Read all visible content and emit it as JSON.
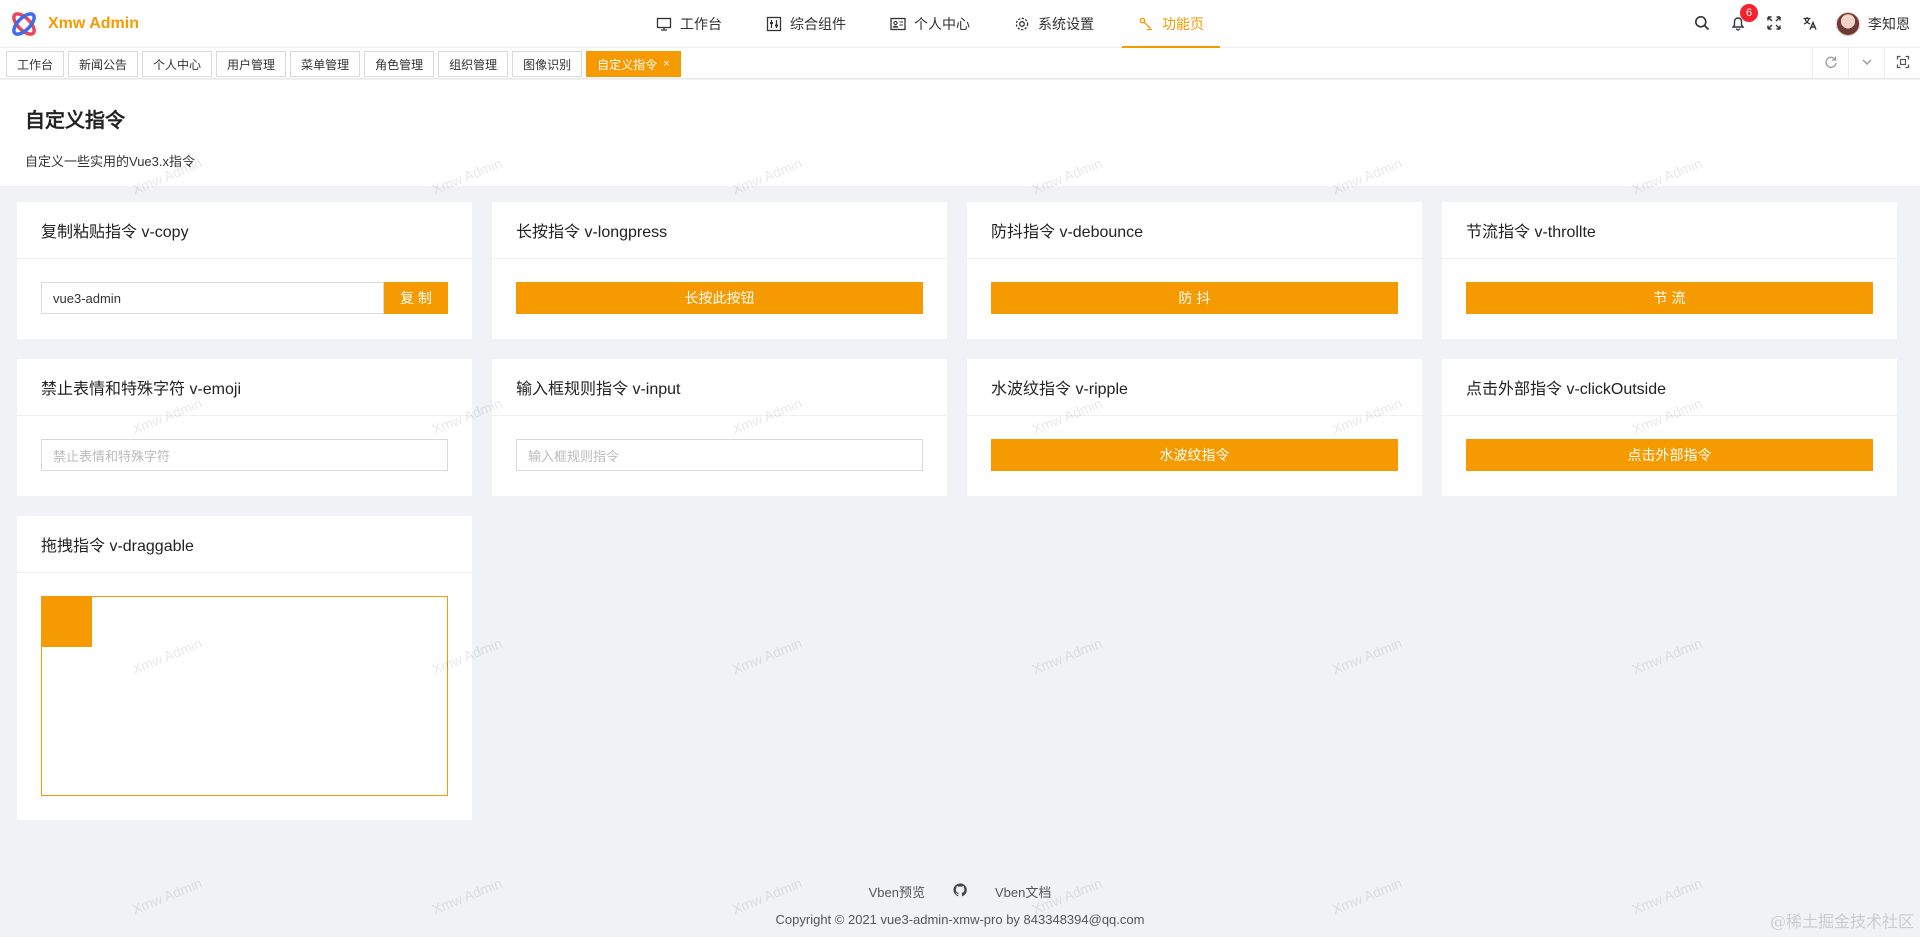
{
  "app": {
    "title": "Xmw Admin"
  },
  "nav": {
    "items": [
      {
        "label": "工作台",
        "icon": "monitor-icon"
      },
      {
        "label": "综合组件",
        "icon": "sliders-icon"
      },
      {
        "label": "个人中心",
        "icon": "id-card-icon"
      },
      {
        "label": "系统设置",
        "icon": "gear-icon"
      },
      {
        "label": "功能页",
        "icon": "function-icon",
        "active": true
      }
    ]
  },
  "header": {
    "notification_count": "6",
    "user_name": "李知恩"
  },
  "tabs": [
    {
      "label": "工作台"
    },
    {
      "label": "新闻公告"
    },
    {
      "label": "个人中心"
    },
    {
      "label": "用户管理"
    },
    {
      "label": "菜单管理"
    },
    {
      "label": "角色管理"
    },
    {
      "label": "组织管理"
    },
    {
      "label": "图像识别"
    },
    {
      "label": "自定义指令",
      "active": true,
      "close": "×"
    }
  ],
  "page": {
    "title": "自定义指令",
    "description": "自定义一些实用的Vue3.x指令"
  },
  "cards": {
    "copy": {
      "title": "复制粘贴指令 v-copy",
      "input_value": "vue3-admin",
      "button": "复 制"
    },
    "longpress": {
      "title": "长按指令 v-longpress",
      "button": "长按此按钮"
    },
    "debounce": {
      "title": "防抖指令 v-debounce",
      "button": "防 抖"
    },
    "throttle": {
      "title": "节流指令 v-throllte",
      "button": "节 流"
    },
    "emoji": {
      "title": "禁止表情和特殊字符 v-emoji",
      "placeholder": "禁止表情和特殊字符"
    },
    "input": {
      "title": "输入框规则指令 v-input",
      "placeholder": "输入框规则指令"
    },
    "ripple": {
      "title": "水波纹指令 v-ripple",
      "button": "水波纹指令"
    },
    "clickoutside": {
      "title": "点击外部指令 v-clickOutside",
      "button": "点击外部指令"
    },
    "draggable": {
      "title": "拖拽指令 v-draggable"
    }
  },
  "footer": {
    "link_preview": "Vben预览",
    "link_docs": "Vben文档",
    "copyright": "Copyright © 2021 vue3-admin-xmw-pro by 843348394@qq.com"
  },
  "watermark": {
    "text": "Xmw Admin"
  },
  "corner_mark": "@稀土掘金技术社区",
  "colors": {
    "accent": "#f59a00",
    "badge": "#f5222d",
    "background": "#f0f2f5"
  }
}
